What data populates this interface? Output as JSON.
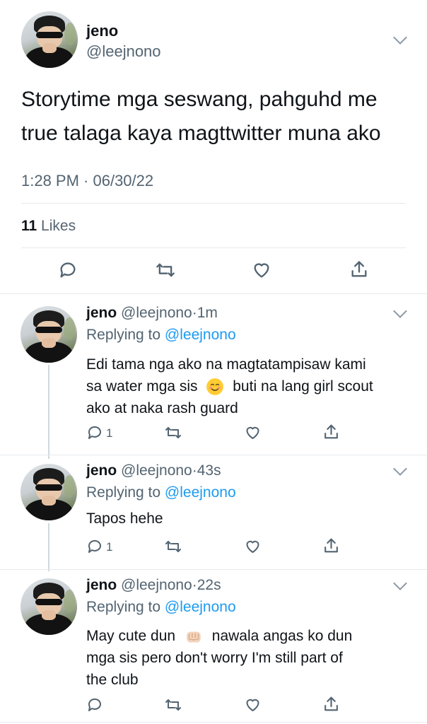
{
  "main_tweet": {
    "author_name": "jeno",
    "author_handle": "@leejnono",
    "text_line1": "Storytime mga seswang, pahguhd me",
    "text_line2": "true talaga kaya magttwitter muna ako",
    "timestamp": "1:28 PM · 06/30/22",
    "likes_count": "11",
    "likes_label": "Likes"
  },
  "replies": [
    {
      "author_name": "jeno",
      "author_handle": "@leejnono",
      "time": "·1m",
      "replying_prefix": "Replying to",
      "replying_to": "@leejnono",
      "line1": "Edi tama nga ako na magtatampisaw kami",
      "line2a": "sa water mga sis",
      "line2b": "buti na lang girl scout",
      "line3": "ako at naka rash guard",
      "reply_count": "1"
    },
    {
      "author_name": "jeno",
      "author_handle": "@leejnono",
      "time": "·43s",
      "replying_prefix": "Replying to",
      "replying_to": "@leejnono",
      "line1": "Tapos hehe",
      "reply_count": "1"
    },
    {
      "author_name": "jeno",
      "author_handle": "@leejnono",
      "time": "·22s",
      "replying_prefix": "Replying to",
      "replying_to": "@leejnono",
      "line1a": "May cute dun",
      "line1b": "nawala angas ko dun",
      "line2": "mga sis pero don't worry I'm still part of",
      "line3": "the club",
      "reply_count": ""
    }
  ],
  "icons": [
    "reply-icon",
    "retweet-icon",
    "like-icon",
    "share-icon",
    "chevron-down-icon"
  ],
  "colors": {
    "link": "#1d9bf0",
    "secondary": "#536471",
    "divider": "#e6e9eb"
  }
}
